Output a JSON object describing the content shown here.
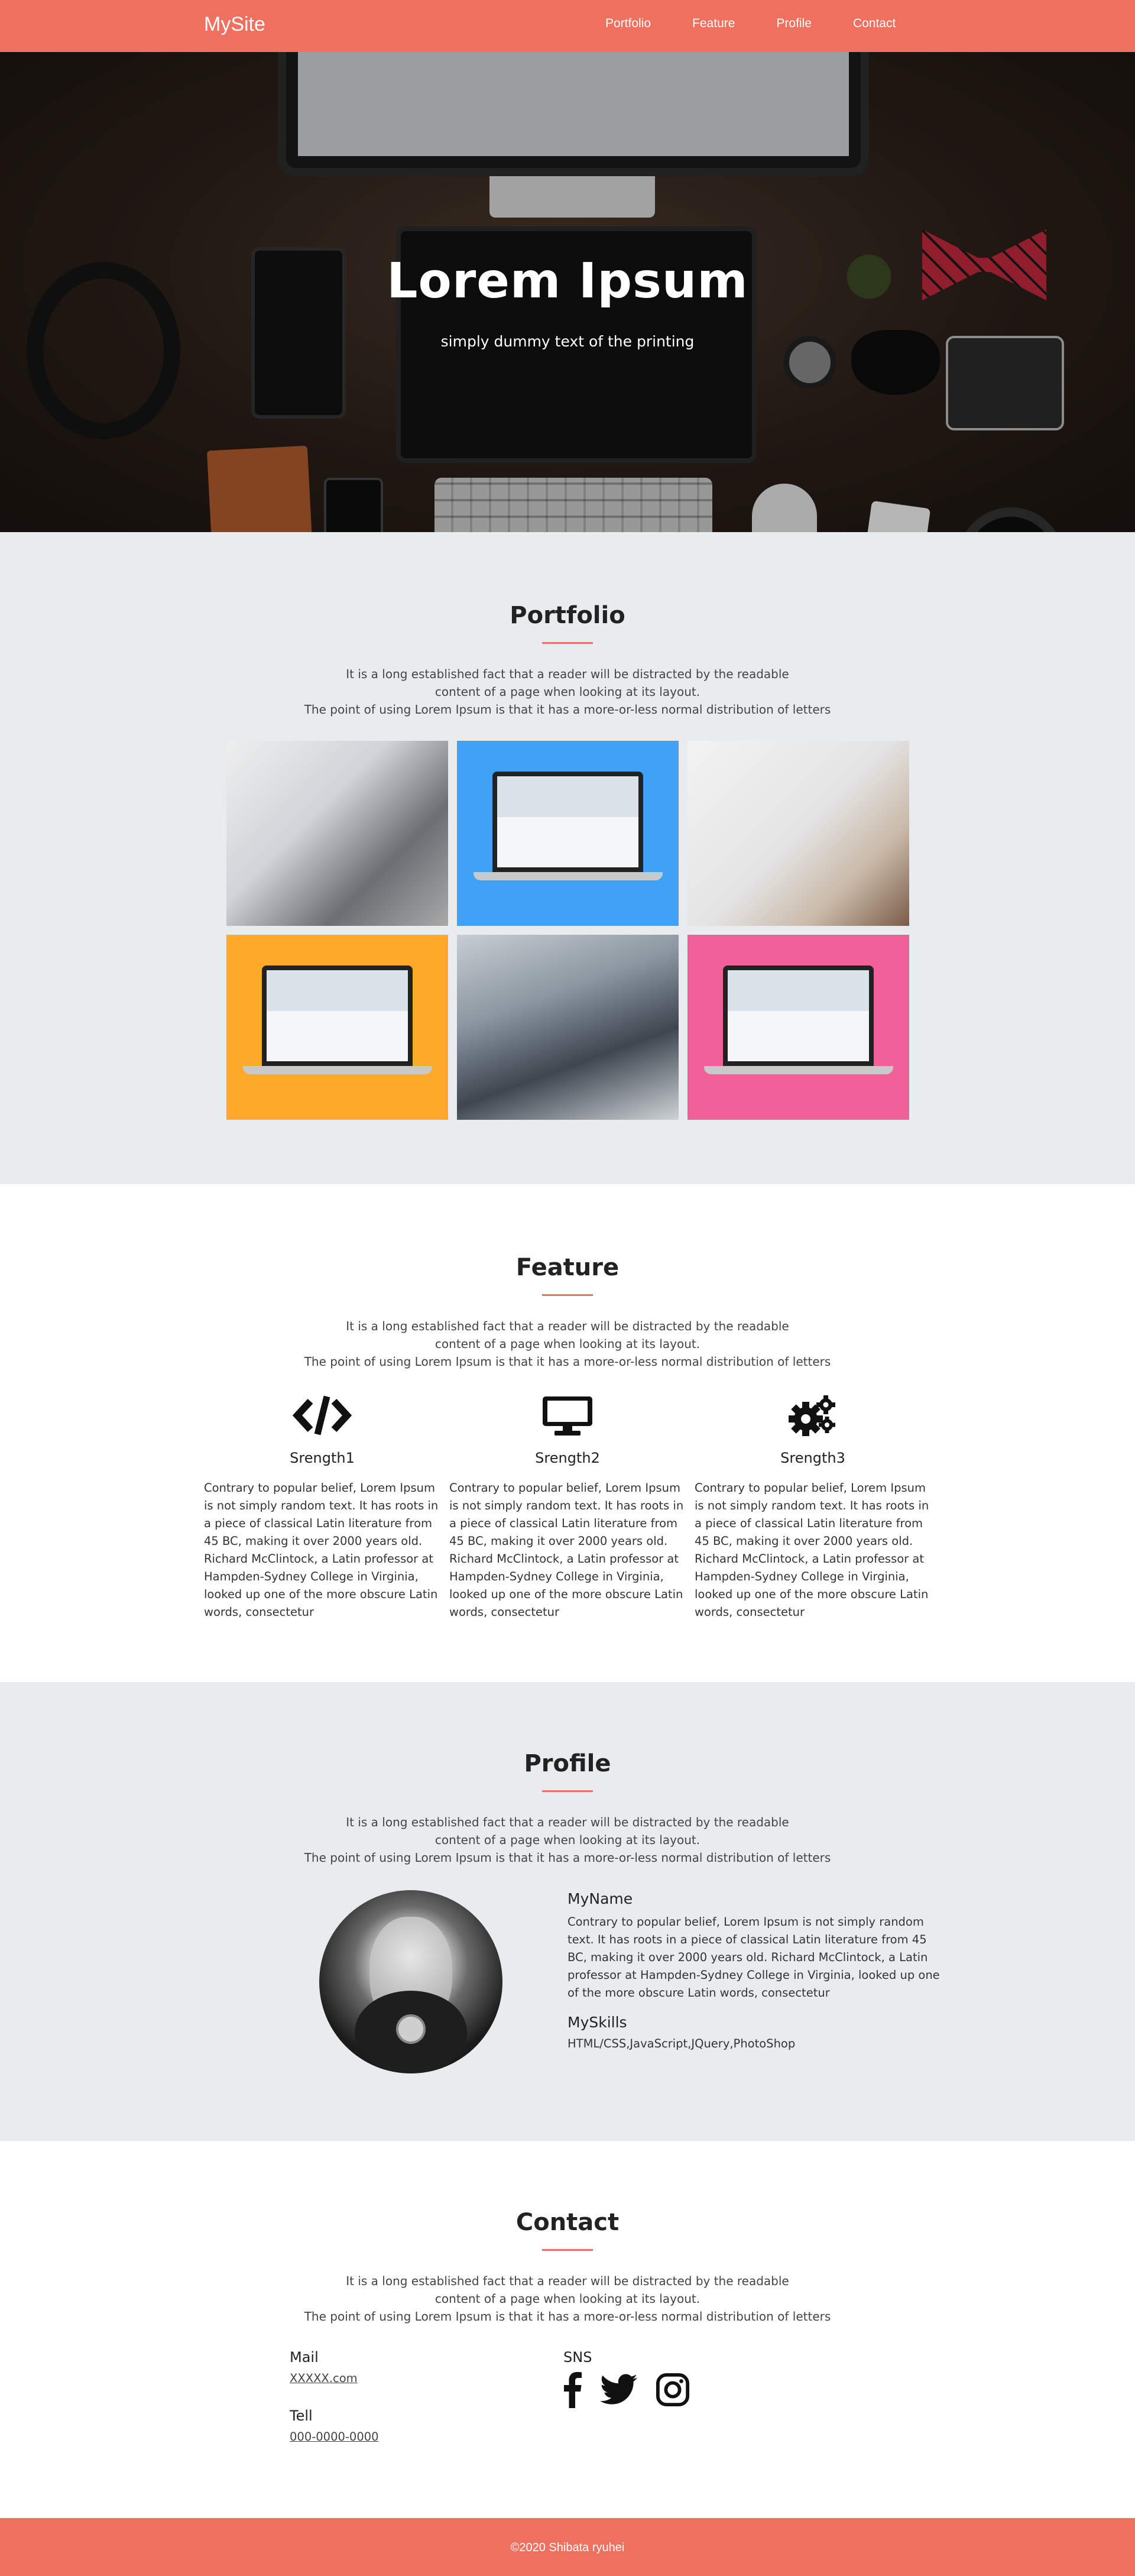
{
  "site": {
    "logo": "MySite"
  },
  "nav": {
    "items": [
      {
        "label": "Portfolio"
      },
      {
        "label": "Feature"
      },
      {
        "label": "Profile"
      },
      {
        "label": "Contact"
      }
    ]
  },
  "hero": {
    "title": "Lorem Ipsum",
    "subtitle": "simply dummy text of the printing"
  },
  "portfolio": {
    "title": "Portfolio",
    "desc_line1": "It is a long established fact that a reader will be distracted by the readable",
    "desc_line2": "content of a page when looking at its layout.",
    "desc_line3": "The point of using Lorem Ipsum is that it has a more-or-less normal distribution of letters"
  },
  "feature": {
    "title": "Feature",
    "desc_line1": "It is a long established fact that a reader will be distracted by the readable",
    "desc_line2": "content of a page when looking at its layout.",
    "desc_line3": "The point of using Lorem Ipsum is that it has a more-or-less normal distribution of letters",
    "items": [
      {
        "name": "Srength1",
        "icon": "code-icon",
        "text": "Contrary to popular belief, Lorem Ipsum is not simply random text. It has roots in a piece of classical Latin literature from 45 BC, making it over 2000 years old. Richard McClintock, a Latin professor at Hampden-Sydney College in Virginia, looked up one of the more obscure Latin words, consectetur"
      },
      {
        "name": "Srength2",
        "icon": "desktop-icon",
        "text": "Contrary to popular belief, Lorem Ipsum is not simply random text. It has roots in a piece of classical Latin literature from 45 BC, making it over 2000 years old. Richard McClintock, a Latin professor at Hampden-Sydney College in Virginia, looked up one of the more obscure Latin words, consectetur"
      },
      {
        "name": "Srength3",
        "icon": "gears-icon",
        "text": "Contrary to popular belief, Lorem Ipsum is not simply random text. It has roots in a piece of classical Latin literature from 45 BC, making it over 2000 years old. Richard McClintock, a Latin professor at Hampden-Sydney College in Virginia, looked up one of the more obscure Latin words, consectetur"
      }
    ]
  },
  "profile": {
    "title": "Profile",
    "desc_line1": "It is a long established fact that a reader will be distracted by the readable",
    "desc_line2": "content of a page when looking at its layout.",
    "desc_line3": "The point of using Lorem Ipsum is that it has a more-or-less normal distribution of letters",
    "name_heading": "MyName",
    "bio": "Contrary to popular belief, Lorem Ipsum is not simply random text. It has roots in a piece of classical Latin literature from 45 BC, making it over 2000 years old. Richard McClintock, a Latin professor at Hampden-Sydney College in Virginia, looked up one of the more obscure Latin words, consectetur",
    "skills_heading": "MySkills",
    "skills": "HTML/CSS,JavaScript,JQuery,PhotoShop"
  },
  "contact": {
    "title": "Contact",
    "desc_line1": "It is a long established fact that a reader will be distracted by the readable",
    "desc_line2": "content of a page when looking at its layout.",
    "desc_line3": "The point of using Lorem Ipsum is that it has a more-or-less normal distribution of letters",
    "mail_label": "Mail",
    "mail_value": "XXXXX.com",
    "tell_label": "Tell",
    "tell_value": "000-0000-0000",
    "sns_label": "SNS",
    "sns_icons": [
      "facebook-icon",
      "twitter-icon",
      "instagram-icon"
    ]
  },
  "footer": {
    "copyright": "©2020 Shibata ryuhei"
  },
  "colors": {
    "accent": "#ef705e",
    "section_gray": "#e9ecef",
    "tile_blue": "#3fa2f4",
    "tile_orange": "#fdaa2b",
    "tile_pink": "#f2609a"
  }
}
